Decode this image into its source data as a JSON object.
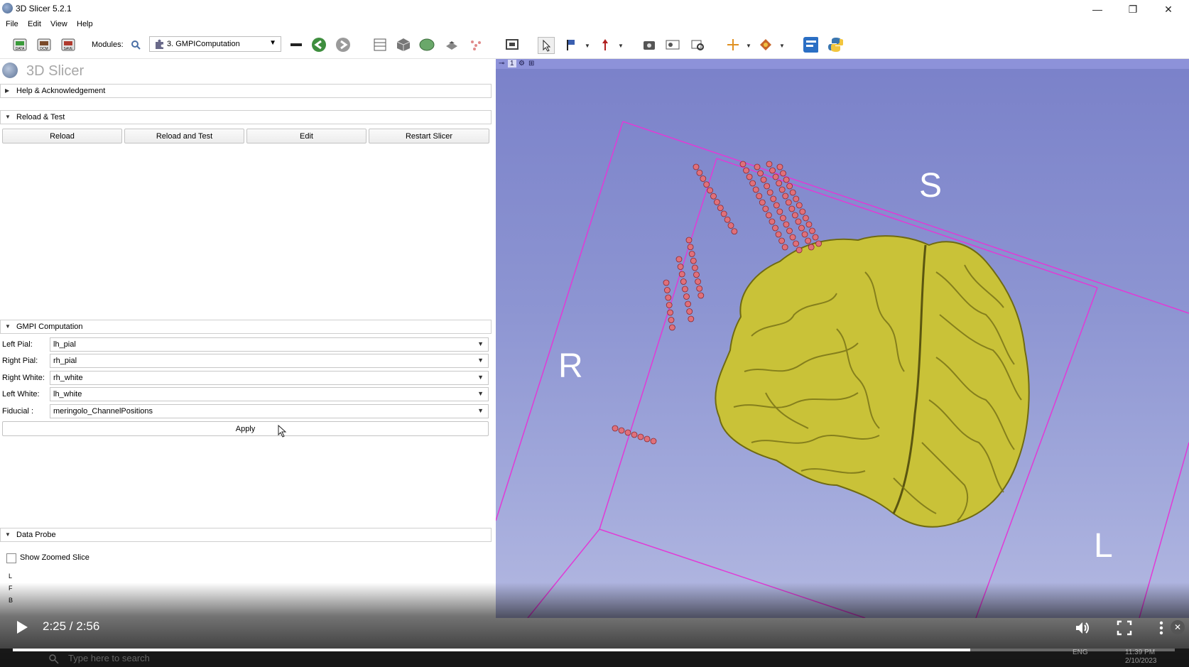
{
  "window": {
    "title": "3D Slicer 5.2.1",
    "minimize": "—",
    "restore": "❐",
    "close": "✕"
  },
  "menu": [
    "File",
    "Edit",
    "View",
    "Help"
  ],
  "toolbar": {
    "data_icon": "DATA",
    "dcm_icon": "DCM",
    "save_icon": "SAVE",
    "modules_label": "Modules:",
    "module_selected": "3. GMPIComputation"
  },
  "logo_text": "3D Slicer",
  "sections": {
    "help": "Help & Acknowledgement",
    "reload_test": "Reload & Test",
    "gmpi": "GMPI Computation",
    "data_probe": "Data Probe"
  },
  "reload_buttons": [
    "Reload",
    "Reload and Test",
    "Edit",
    "Restart Slicer"
  ],
  "gmpi_fields": [
    {
      "label": "Left Pial:",
      "value": "lh_pial"
    },
    {
      "label": "Right Pial:",
      "value": "rh_pial"
    },
    {
      "label": "Right White:",
      "value": "rh_white"
    },
    {
      "label": "Left White:",
      "value": "lh_white"
    },
    {
      "label": "Fiducial :",
      "value": "meringolo_ChannelPositions"
    }
  ],
  "apply_label": "Apply",
  "data_probe": {
    "show_zoomed": "Show Zoomed Slice",
    "rows": [
      "L",
      "F",
      "B"
    ]
  },
  "view3d": {
    "viewbar_index": "1",
    "orient_S": "S",
    "orient_R": "R",
    "orient_L": "L",
    "brain_color": "#c9c238",
    "fiducial_color": "#e0707a"
  },
  "video": {
    "time": "2:25 / 2:56",
    "progress": 0.824
  },
  "taskbar": {
    "search_placeholder": "Type here to search",
    "lang": "ENG",
    "time": "11:39 PM",
    "date": "2/10/2023"
  }
}
